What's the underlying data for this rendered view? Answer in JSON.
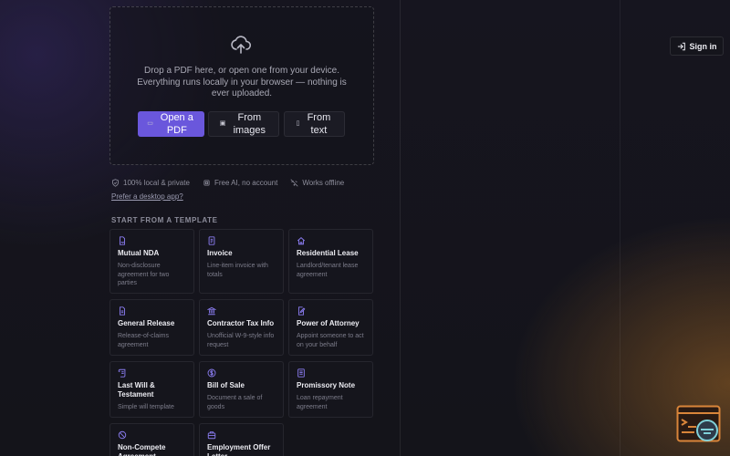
{
  "dropzone": {
    "icon": "cloud-upload-icon",
    "text": "Drop a PDF here, or open one from your device. Everything runs locally in your browser — nothing is ever uploaded.",
    "open_pdf_label": "Open a PDF",
    "from_images_label": "From images",
    "from_text_label": "From text"
  },
  "features": {
    "local": "100% local & private",
    "ai": "Free AI, no account",
    "offline": "Works offline",
    "desktop_link": "Prefer a desktop app?"
  },
  "templates": {
    "heading": "START FROM A TEMPLATE",
    "items": [
      {
        "title": "Mutual NDA",
        "desc": "Non-disclosure agreement for two parties",
        "icon": "signature-doc-icon"
      },
      {
        "title": "Invoice",
        "desc": "Line-item invoice with totals",
        "icon": "invoice-icon"
      },
      {
        "title": "Residential Lease",
        "desc": "Landlord/tenant lease agreement",
        "icon": "home-icon"
      },
      {
        "title": "General Release",
        "desc": "Release-of-claims agreement",
        "icon": "document-icon"
      },
      {
        "title": "Contractor Tax Info",
        "desc": "Unofficial W-9-style info request",
        "icon": "bank-icon"
      },
      {
        "title": "Power of Attorney",
        "desc": "Appoint someone to act on your behalf",
        "icon": "edit-doc-icon"
      },
      {
        "title": "Last Will & Testament",
        "desc": "Simple will template",
        "icon": "scroll-icon"
      },
      {
        "title": "Bill of Sale",
        "desc": "Document a sale of goods",
        "icon": "dollar-icon"
      },
      {
        "title": "Promissory Note",
        "desc": "Loan repayment agreement",
        "icon": "note-icon"
      },
      {
        "title": "Non-Compete Agreement",
        "desc": "",
        "icon": "ban-icon"
      },
      {
        "title": "Employment Offer Letter",
        "desc": "",
        "icon": "briefcase-icon"
      }
    ]
  },
  "header": {
    "signin_label": "Sign in"
  },
  "colors": {
    "accent": "#6a57dc",
    "icon_accent": "#8a7cf0",
    "background": "#14141a"
  }
}
